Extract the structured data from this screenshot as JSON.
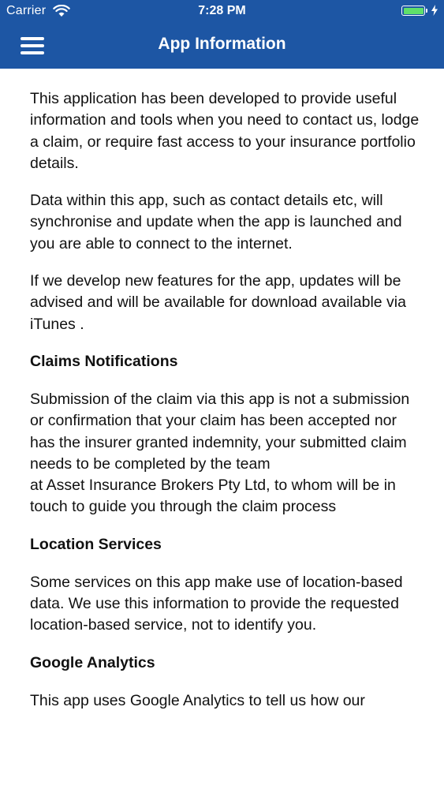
{
  "status_bar": {
    "carrier": "Carrier",
    "time": "7:28 PM",
    "wifi_icon": "wifi-icon",
    "battery_icon": "battery-icon",
    "battery_color": "#5fe06a",
    "charge_icon": "charging-bolt-icon"
  },
  "header": {
    "title": "App Information",
    "menu_icon": "hamburger-menu-icon",
    "background_color": "#1d56a4"
  },
  "content": {
    "intro_1": "This application has been developed to provide useful information and tools when you need to contact us, lodge a claim, or require fast access to your insurance portfolio details.",
    "intro_2": "Data within this app, such as contact details etc, will synchronise and update when the app is launched and you are able to connect to the internet.",
    "intro_3": "If we develop new features for the app, updates will be advised and will be available for download available via iTunes .",
    "claims_heading": "Claims Notifications",
    "claims_text_1": "Submission of the claim via this app is not a submission or confirmation that your claim has been accepted nor has the insurer granted indemnity,  your submitted claim needs to be completed by the team",
    "claims_text_2": "at Asset Insurance Brokers Pty Ltd, to whom will be in touch to guide you through the claim process",
    "location_heading": "Location Services",
    "location_text": "Some services on this app make use of location-based data. We use this information to provide the requested location-based service, not to identify you.",
    "analytics_heading": "Google Analytics",
    "analytics_text": "This app uses Google Analytics to tell us how our"
  }
}
